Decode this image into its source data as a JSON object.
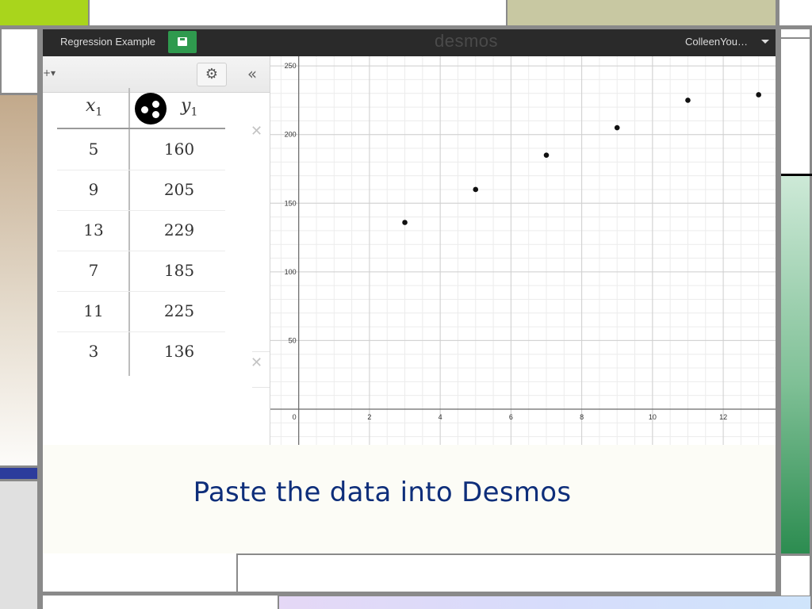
{
  "app": {
    "graph_title": "Regression Example",
    "brand": "desmos",
    "user": "ColleenYou…"
  },
  "icons": {
    "save": "floppy-disk-icon",
    "settings": "gear-icon",
    "collapse": "double-chevron-left-icon",
    "close": "close-icon",
    "add_menu": "plus-dropdown-icon",
    "points_style": "points-style-icon",
    "user_menu": "caret-down-icon"
  },
  "glyphs": {
    "add_menu": "+▾",
    "settings": "⚙",
    "collapse": "«",
    "close": "✕"
  },
  "table": {
    "headers": {
      "x": "x",
      "x_sub": "1",
      "y": "y",
      "y_sub": "1"
    },
    "rows": [
      {
        "x": "5",
        "y": "160"
      },
      {
        "x": "9",
        "y": "205"
      },
      {
        "x": "13",
        "y": "229"
      },
      {
        "x": "7",
        "y": "185"
      },
      {
        "x": "11",
        "y": "225"
      },
      {
        "x": "3",
        "y": "136"
      }
    ]
  },
  "chart_data": {
    "type": "scatter",
    "title": "",
    "xlabel": "",
    "ylabel": "",
    "x_ticks": [
      "0",
      "2",
      "4",
      "6",
      "8",
      "10",
      "12"
    ],
    "y_ticks": [
      "50",
      "100",
      "150",
      "200",
      "250"
    ],
    "xlim": [
      -0.8,
      13.5
    ],
    "ylim": [
      -26,
      257
    ],
    "grid": true,
    "series": [
      {
        "x": [
          5,
          9,
          13,
          7,
          11,
          3
        ],
        "y": [
          160,
          205,
          229,
          185,
          225,
          136
        ]
      }
    ]
  },
  "caption": "Paste the data into Desmos",
  "colors": {
    "topbar": "#2a2a2a",
    "save_button": "#2f9a4e",
    "caption_text": "#0e2e7a",
    "accent_green": "#a9d51c",
    "accent_blue": "#2c3c9c"
  }
}
